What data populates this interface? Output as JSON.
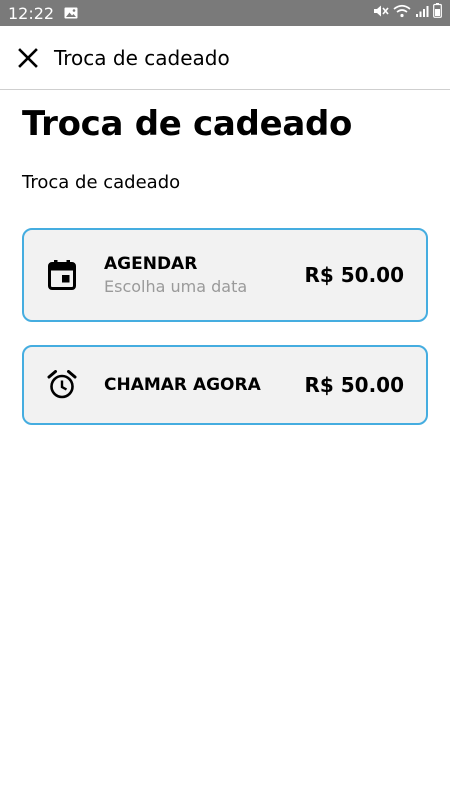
{
  "status_bar": {
    "time": "12:22",
    "icons": [
      "gallery-icon",
      "mute-icon",
      "wifi-icon",
      "signal-icon",
      "battery-icon"
    ]
  },
  "app_bar": {
    "close_icon": "close-icon",
    "title": "Troca de cadeado"
  },
  "main": {
    "title": "Troca de cadeado",
    "subtitle": "Troca de cadeado",
    "options": [
      {
        "icon": "calendar-icon",
        "label": "AGENDAR",
        "sublabel": "Escolha uma data",
        "price": "R$ 50.00"
      },
      {
        "icon": "alarm-clock-icon",
        "label": "CHAMAR AGORA",
        "price": "R$ 50.00"
      }
    ]
  },
  "colors": {
    "status_bar": "#7a7a7a",
    "card_border": "#45ade0",
    "card_background": "#f2f2f2",
    "sublabel": "#9a9a9a"
  }
}
